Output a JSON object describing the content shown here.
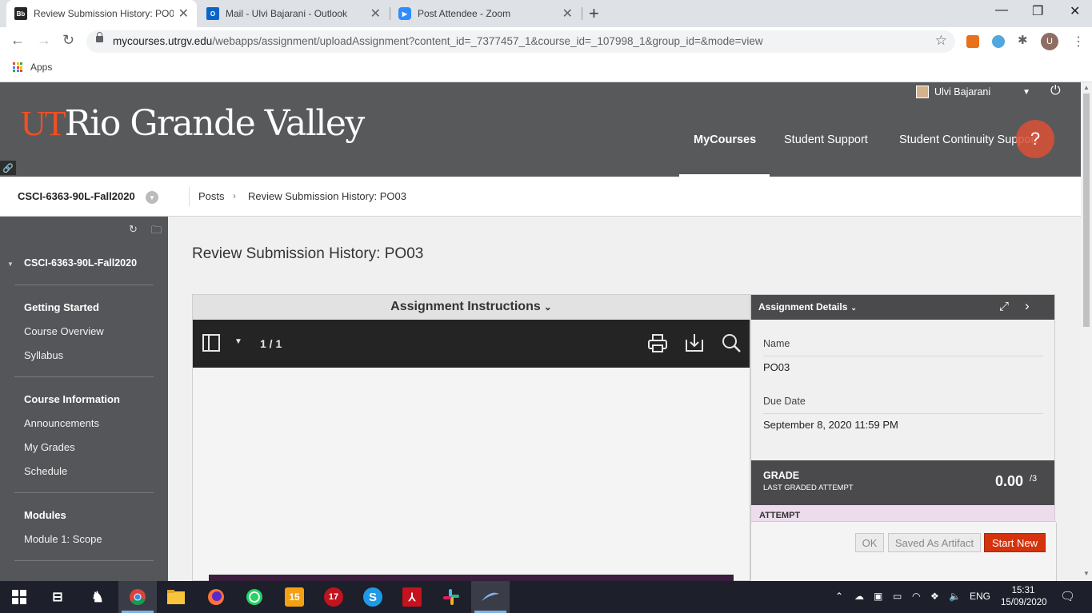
{
  "browser": {
    "tabs": [
      {
        "title": "Review Submission History: PO03",
        "favicon": "Bb",
        "active": true
      },
      {
        "title": "Mail - Ulvi Bajarani - Outlook",
        "favicon": "O",
        "active": false
      },
      {
        "title": "Post Attendee - Zoom",
        "favicon": "zoom",
        "active": false
      }
    ],
    "url_host": "mycourses.utrgv.edu",
    "url_path": "/webapps/assignment/uploadAssignment?content_id=_7377457_1&course_id=_107998_1&group_id=&mode=view",
    "profile_initial": "U",
    "bookmark_apps": "Apps"
  },
  "header": {
    "logo_ut": "UT",
    "logo_rest": "Rio Grande Valley",
    "user_name": "Ulvi Bajarani",
    "nav": [
      "MyCourses",
      "Student Support",
      "Student Continuity Support"
    ]
  },
  "breadcrumb": {
    "course": "CSCI-6363-90L-Fall2020",
    "items": [
      "Posts",
      "Review Submission History: PO03"
    ]
  },
  "sidebar": {
    "course": "CSCI-6363-90L-Fall2020",
    "sections": [
      {
        "heading": "Getting Started",
        "items": [
          "Course Overview",
          "Syllabus"
        ]
      },
      {
        "heading": "Course Information",
        "items": [
          "Announcements",
          "My Grades",
          "Schedule"
        ]
      },
      {
        "heading": "Modules",
        "items": [
          "Module 1: Scope"
        ]
      }
    ]
  },
  "content": {
    "title": "Review Submission History: PO03",
    "viewer_header": "Assignment Instructions",
    "page_indicator": "1 / 1"
  },
  "details": {
    "header": "Assignment Details",
    "name_label": "Name",
    "name_value": "PO03",
    "due_label": "Due Date",
    "due_value": "September 8, 2020 11:59 PM",
    "grade_label": "GRADE",
    "grade_sub": "LAST GRADED ATTEMPT",
    "grade_score": "0.00",
    "grade_max": "/3",
    "attempt_label": "ATTEMPT"
  },
  "popup": {
    "ok": "OK",
    "saved": "Saved As Artifact",
    "start": "Start New"
  },
  "taskbar": {
    "badge1": "15",
    "badge2": "17",
    "lang": "ENG",
    "time": "15:31",
    "date": "15/09/2020"
  },
  "colors": {
    "brand_orange": "#f05023",
    "header_gray": "#58595b",
    "sidebar_gray": "#555659",
    "start_new": "#d4330d"
  }
}
